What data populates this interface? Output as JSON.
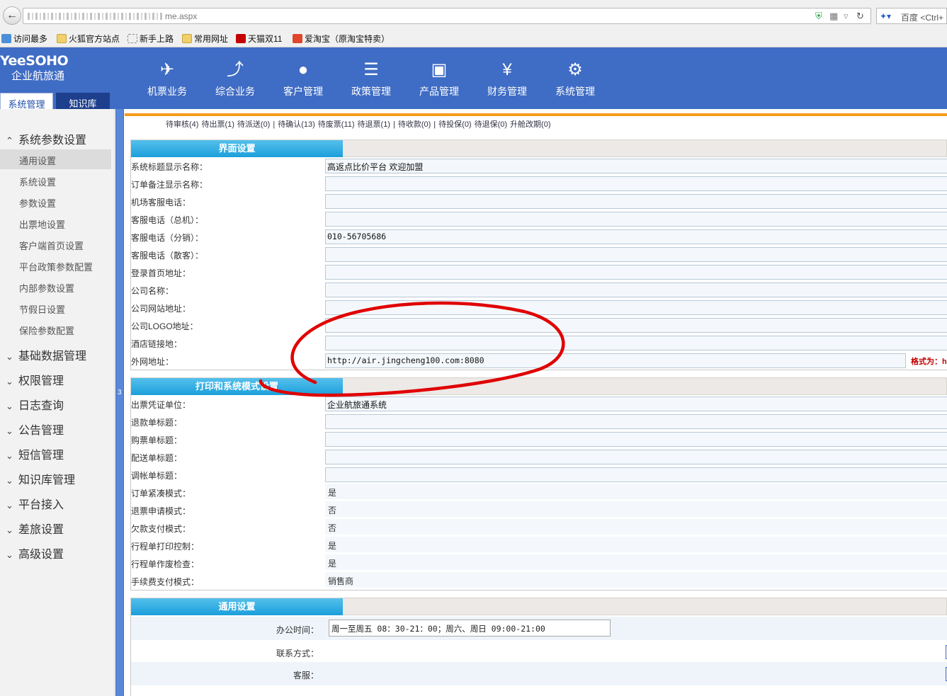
{
  "browser": {
    "url_visible": "me.aspx",
    "search_label": "百度 <Ctrl+",
    "bookmarks": [
      "访问最多",
      "火狐官方站点",
      "新手上路",
      "常用网址",
      "天猫双11",
      "爱淘宝（原淘宝特卖）"
    ]
  },
  "header": {
    "logo_en": "YeeSOHO",
    "logo_cn": "企业航旅通",
    "nav": [
      {
        "label": "机票业务",
        "icon": "airplane-icon"
      },
      {
        "label": "综合业务",
        "icon": "branch-arrows-icon"
      },
      {
        "label": "客户管理",
        "icon": "user-icon"
      },
      {
        "label": "政策管理",
        "icon": "stack-icon"
      },
      {
        "label": "产品管理",
        "icon": "factory-icon"
      },
      {
        "label": "财务管理",
        "icon": "yen-icon"
      },
      {
        "label": "系统管理",
        "icon": "gear-icon"
      }
    ],
    "tabs": [
      "系统管理",
      "知识库"
    ]
  },
  "sidebar": {
    "groups": [
      {
        "label": "系统参数设置",
        "expanded": true,
        "items": [
          "通用设置",
          "系统设置",
          "参数设置",
          "出票地设置",
          "客户端首页设置",
          "平台政策参数配置",
          "内部参数设置",
          "节假日设置",
          "保险参数配置"
        ]
      },
      {
        "label": "基础数据管理"
      },
      {
        "label": "权限管理"
      },
      {
        "label": "日志查询"
      },
      {
        "label": "公告管理"
      },
      {
        "label": "短信管理"
      },
      {
        "label": "知识库管理"
      },
      {
        "label": "平台接入"
      },
      {
        "label": "差旅设置"
      },
      {
        "label": "高级设置"
      }
    ],
    "active_item": "通用设置"
  },
  "splitter_label": "3",
  "pending_bar": {
    "items": [
      "待审核(4)",
      "待出票(1)",
      "待派送(0)",
      "|",
      "待确认(13)",
      "待废票(11)",
      "待退票(1)",
      "|",
      "待收款(0)",
      "|",
      "待投保(0)",
      "待退保(0)",
      "升舱改期(0)"
    ]
  },
  "ui_settings": {
    "title": "界面设置",
    "rows": [
      {
        "label": "系统标题显示名称：",
        "value": "高返点比价平台 欢迎加盟"
      },
      {
        "label": "订单备注显示名称：",
        "value": ""
      },
      {
        "label": "机场客服电话：",
        "value": ""
      },
      {
        "label": "客服电话（总机）：",
        "value": ""
      },
      {
        "label": "客服电话（分销）：",
        "value": "010-56705686"
      },
      {
        "label": "客服电话（散客）：",
        "value": ""
      },
      {
        "label": "登录首页地址：",
        "value": ""
      },
      {
        "label": "公司名称：",
        "value": ""
      },
      {
        "label": "公司网站地址：",
        "value": ""
      },
      {
        "label": "公司LOGO地址：",
        "value": ""
      },
      {
        "label": "酒店链接地：",
        "value": ""
      },
      {
        "label": "外网地址：",
        "value": "http://air.jingcheng100.com:8080",
        "note": "格式为：h"
      }
    ]
  },
  "print_settings": {
    "title": "打印和系统模式设置",
    "inputs": [
      {
        "label": "出票凭证单位：",
        "value": "企业航旅通系统"
      },
      {
        "label": "退款单标题：",
        "value": ""
      },
      {
        "label": "购票单标题：",
        "value": ""
      },
      {
        "label": "配送单标题：",
        "value": ""
      },
      {
        "label": "调帐单标题：",
        "value": ""
      }
    ],
    "statics": [
      {
        "label": "订单紧凑模式：",
        "value": "是"
      },
      {
        "label": "退票申请模式：",
        "value": "否"
      },
      {
        "label": "欠款支付模式：",
        "value": "否"
      },
      {
        "label": "行程单打印控制：",
        "value": "是"
      },
      {
        "label": "行程单作废检查：",
        "value": "是"
      },
      {
        "label": "手续费支付模式：",
        "value": "销售商"
      }
    ]
  },
  "general_settings": {
    "title": "通用设置",
    "office_hours_label": "办公时间：",
    "office_hours_value": "周一至周五 08：30-21：00；周六、周日 09:00-21:00",
    "contact_label": "联系方式：",
    "service_label": "客服："
  },
  "colors": {
    "header_blue": "#3f6cc4",
    "section_title_blue": "#1c9fdb",
    "orange_line": "#f59c1a",
    "annotation_red": "#e00000"
  }
}
